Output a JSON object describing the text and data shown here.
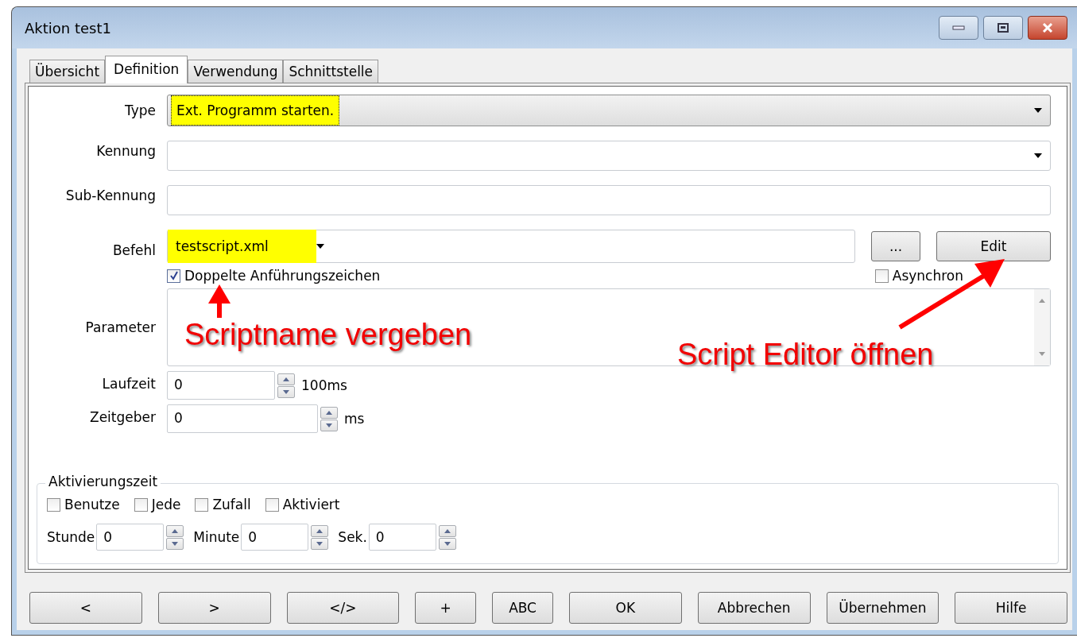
{
  "window": {
    "title": "Aktion test1"
  },
  "tabs": [
    {
      "label": "Übersicht",
      "selected": false
    },
    {
      "label": "Definition",
      "selected": true
    },
    {
      "label": "Verwendung",
      "selected": false
    },
    {
      "label": "Schnittstelle",
      "selected": false
    }
  ],
  "form": {
    "type": {
      "label": "Type",
      "value": "Ext. Programm starten.",
      "highlighted": true
    },
    "kennung": {
      "label": "Kennung"
    },
    "sub_kennung": {
      "label": "Sub-Kennung"
    },
    "befehl": {
      "label": "Befehl",
      "value": "testscript.xml",
      "highlighted": true,
      "browse_button": "...",
      "edit_button": "Edit"
    },
    "checks": [
      {
        "label": "Doppelte Anführungszeichen",
        "checked": true
      },
      {
        "label": "Asynchron",
        "checked": false
      }
    ],
    "parameter": {
      "label": "Parameter"
    },
    "laufzeit": {
      "label": "Laufzeit",
      "value": "0",
      "unit": "100ms"
    },
    "zeitgeber": {
      "label": "Zeitgeber",
      "value": "0",
      "unit": "ms"
    }
  },
  "aktivierungszeit": {
    "title": "Aktivierungszeit",
    "checks": [
      {
        "label": "Benutze",
        "checked": false
      },
      {
        "label": "Jede",
        "checked": false
      },
      {
        "label": "Zufall",
        "checked": false
      },
      {
        "label": "Aktiviert",
        "checked": false
      }
    ],
    "spinners": [
      {
        "label": "Stunde",
        "value": "0"
      },
      {
        "label": "Minute",
        "value": "0"
      },
      {
        "label": "Sek.",
        "value": "0"
      }
    ]
  },
  "buttons": [
    "<",
    ">",
    "</>",
    "+",
    "ABC",
    "OK",
    "Abbrechen",
    "Übernehmen",
    "Hilfe"
  ],
  "annotations": [
    {
      "text": "Scriptname vergeben",
      "kind": "up"
    },
    {
      "text": "Script Editor öffnen",
      "kind": "up-right"
    }
  ]
}
